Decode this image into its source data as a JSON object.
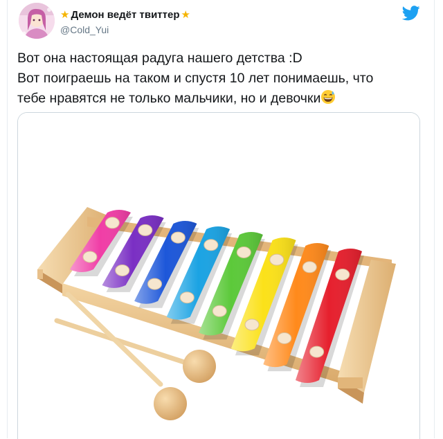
{
  "author": {
    "display_name": "Демон ведёт твиттер",
    "handle": "@Cold_Yui",
    "name_decoration": "star-icon"
  },
  "tweet": {
    "lines": [
      "Вот она настоящая радуга нашего детства :D",
      "Вот поиграешь на таком и спустя 10 лет понимаешь, что",
      "тебе нравятся не только мальчики, но и девочки"
    ],
    "emoji": "grinning-face-with-sweat"
  },
  "brand": {
    "icon": "twitter-bird-icon",
    "color": "#1da1f2"
  },
  "media": {
    "subject": "xylophone-image",
    "bar_colors": [
      "#f03ea6",
      "#7a2fc4",
      "#1d57d9",
      "#1ba3e3",
      "#5cc93a",
      "#fbe11a",
      "#ff8a1c",
      "#e6202e"
    ]
  }
}
